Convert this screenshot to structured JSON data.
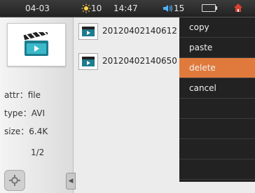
{
  "status_bar": {
    "date": "04-03",
    "brightness": "10",
    "time": "14:47",
    "volume": "15",
    "icons": [
      "sun-icon",
      "volume-icon",
      "battery-icon",
      "home-icon"
    ]
  },
  "left_panel": {
    "thumbnail_icon": "video-clapperboard-icon",
    "attr": "attr：file",
    "type": "type：AVI",
    "size": "size：6.4K",
    "page": "1/2"
  },
  "files": [
    {
      "name": "20120402140612",
      "icon": "video-file-icon"
    },
    {
      "name": "20120402140650",
      "icon": "video-file-icon"
    }
  ],
  "context_menu": {
    "items": [
      "copy",
      "paste",
      "delete",
      "cancel"
    ],
    "highlighted_index": 2,
    "highlight_color": "#e07a3c",
    "background_color": "#222222"
  }
}
